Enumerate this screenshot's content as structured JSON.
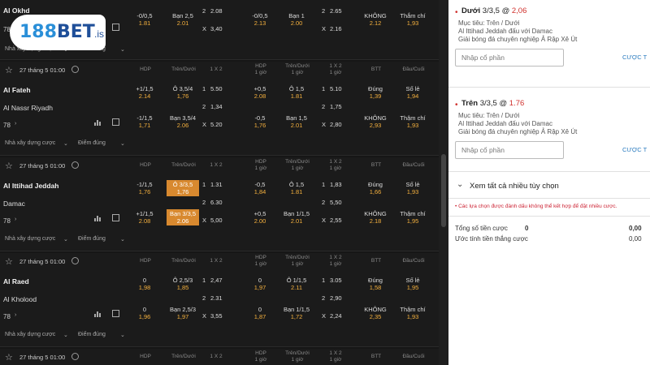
{
  "brand": {
    "num": "188",
    "name": "BET",
    "suffix": ".is"
  },
  "top_partial": {
    "team": "Al Okhd",
    "count": "78",
    "footer_left": "Nhà xây dựng cược",
    "footer_right": "Điểm đúng",
    "row1": [
      [
        "-0/0,5",
        "1.81"
      ],
      [
        "Bạn 2,5",
        "2.01"
      ],
      [
        "2",
        "2.08"
      ],
      [
        "-0/0,5",
        "2.13"
      ],
      [
        "Bạn 1",
        "2.00"
      ],
      [
        "2",
        "2.65"
      ],
      [
        "KHÔNG",
        "2.12"
      ],
      [
        "Thắm chí",
        "1,93"
      ]
    ],
    "row0": [
      [
        "",
        "1.93"
      ],
      [
        "",
        "1.95"
      ],
      [
        "X",
        "3,40"
      ],
      [
        "",
        "1.52"
      ],
      [
        "",
        "2.05"
      ],
      [
        "X",
        "2.16"
      ],
      [
        "",
        "1.63"
      ],
      [
        "",
        "1.63"
      ]
    ]
  },
  "col_headers": [
    "HDP",
    "Trên/Dưới",
    "1 X 2",
    "HDP\n1 giờ",
    "Trên/Dưới\n1 giờ",
    "1 X 2\n1 giờ",
    "BTT",
    "Đầu/Cuối"
  ],
  "matches": [
    {
      "date": "27 tháng 5 01:00",
      "team1": "Al Fateh",
      "team2": "Al Nassr Riyadh",
      "count": "78",
      "footer_left": "Nhà xây dựng cược",
      "footer_right": "Điểm đúng",
      "row1": [
        [
          "+1/1,5",
          "2.14"
        ],
        [
          "Ô 3,5/4",
          "1,76"
        ],
        [
          "1",
          "5.50"
        ],
        [
          "+0,5",
          "2.08"
        ],
        [
          "Ô 1,5",
          "1.81"
        ],
        [
          "1",
          "5.10"
        ],
        [
          "Đúng",
          "1,39"
        ],
        [
          "Số lẻ",
          "1,94"
        ]
      ],
      "row2": [
        [
          "",
          "",
          ""
        ],
        [
          "",
          "",
          ""
        ],
        [
          "2",
          "1,34"
        ],
        [
          "",
          "",
          ""
        ],
        [
          "",
          "",
          ""
        ],
        [
          "2",
          "1,75"
        ],
        [
          "",
          "",
          ""
        ],
        [
          "",
          "",
          ""
        ]
      ],
      "row3": [
        [
          "-1/1,5",
          "1,71"
        ],
        [
          "Bạn 3,5/4",
          "2.06"
        ],
        [
          "X",
          "5.20"
        ],
        [
          "-0,5",
          "1,76"
        ],
        [
          "Bạn 1,5",
          "2.01"
        ],
        [
          "X",
          "2,80"
        ],
        [
          "KHÔNG",
          "2,93"
        ],
        [
          "Thậm chí",
          "1,93"
        ]
      ],
      "sel": null
    },
    {
      "date": "27 tháng 5 01:00",
      "team1": "Al Ittihad Jeddah",
      "team2": "Damac",
      "count": "78",
      "footer_left": "Nhà xây dựng cược",
      "footer_right": "Điểm đúng",
      "row1": [
        [
          "-1/1,5",
          "1,76"
        ],
        [
          "Ô 3/3,5",
          "1,76"
        ],
        [
          "1",
          "1.31"
        ],
        [
          "-0,5",
          "1,84"
        ],
        [
          "Ô 1,5",
          "1.81"
        ],
        [
          "1",
          "1,83"
        ],
        [
          "Đúng",
          "1,66"
        ],
        [
          "Số lẻ",
          "1,93"
        ]
      ],
      "row2": [
        [
          "",
          "",
          ""
        ],
        [
          "",
          "",
          ""
        ],
        [
          "2",
          "6.30"
        ],
        [
          "",
          "",
          ""
        ],
        [
          "",
          "",
          ""
        ],
        [
          "2",
          "5,50"
        ],
        [
          "",
          "",
          ""
        ],
        [
          "",
          "",
          ""
        ]
      ],
      "row3": [
        [
          "+1/1,5",
          "2.08"
        ],
        [
          "Bạn 3/3,5",
          "2.06"
        ],
        [
          "X",
          "5,00"
        ],
        [
          "+0,5",
          "2.00"
        ],
        [
          "Bạn 1/1,5",
          "2.01"
        ],
        [
          "X",
          "2,55"
        ],
        [
          "KHÔNG",
          "2.18"
        ],
        [
          "Thậm chí",
          "1,95"
        ]
      ],
      "sel": "ou"
    },
    {
      "date": "27 tháng 5 01:00",
      "team1": "Al Raed",
      "team2": "Al Kholood",
      "count": "78",
      "footer_left": "Nhà xây dựng cược",
      "footer_right": "Điểm đúng",
      "row1": [
        [
          "0",
          "1,98"
        ],
        [
          "Ô 2,5/3",
          "1,85"
        ],
        [
          "1",
          "2,47"
        ],
        [
          "0",
          "1,97"
        ],
        [
          "Ô 1/1,5",
          "2.11"
        ],
        [
          "1",
          "3.05"
        ],
        [
          "Đúng",
          "1,58"
        ],
        [
          "Số lẻ",
          "1,95"
        ]
      ],
      "row2": [
        [
          "",
          "",
          ""
        ],
        [
          "",
          "",
          ""
        ],
        [
          "2",
          "2.31"
        ],
        [
          "",
          "",
          ""
        ],
        [
          "",
          "",
          ""
        ],
        [
          "2",
          "2,90"
        ],
        [
          "",
          "",
          ""
        ],
        [
          "",
          "",
          ""
        ]
      ],
      "row3": [
        [
          "0",
          "1,96"
        ],
        [
          "Bạn 2,5/3",
          "1,97"
        ],
        [
          "X",
          "3,55"
        ],
        [
          "0",
          "1,87"
        ],
        [
          "Bạn 1/1,5",
          "1,72"
        ],
        [
          "X",
          "2,24"
        ],
        [
          "KHÔNG",
          "2,35"
        ],
        [
          "Thậm chí",
          "1,93"
        ]
      ],
      "sel": null
    },
    {
      "date": "27 tháng 5 01:00",
      "team1": "",
      "team2": "",
      "count": "",
      "footer_left": "",
      "footer_right": "",
      "row1": [],
      "row2": [],
      "row3": [],
      "sel": null
    }
  ],
  "betslip": {
    "bets": [
      {
        "pick": "Dưới",
        "line": "3/3,5",
        "at": "@",
        "odds": "2,06",
        "market": "Mục tiêu: Trên / Dưới",
        "match": "Al Ittihad Jeddah đấu với Damac",
        "league": "Giải bóng đá chuyên nghiệp Ả Rập Xê Út",
        "stake_placeholder": "Nhập cổ phần",
        "cuoc": "CƯỢC T"
      },
      {
        "pick": "Trên",
        "line": "3/3,5",
        "at": "@",
        "odds": "1.76",
        "market": "Mục tiêu: Trên / Dưới",
        "match": "Al Ittihad Jeddah đấu với Damac",
        "league": "Giải bóng đá chuyên nghiệp Ả Rập Xê Út",
        "stake_placeholder": "Nhập cổ phần",
        "cuoc": "CƯỢC T"
      }
    ],
    "more_label": "Xem tất cả nhiều tùy chọn",
    "warning": "• Các lựa chọn được đánh dấu không thể kết hợp để đặt nhiều cược.",
    "total_label": "Tổng số tiền cược",
    "total_value": "0",
    "total_right": "0,00",
    "est_label": "Ước tính tiền thắng cược",
    "est_right": "0,00"
  }
}
